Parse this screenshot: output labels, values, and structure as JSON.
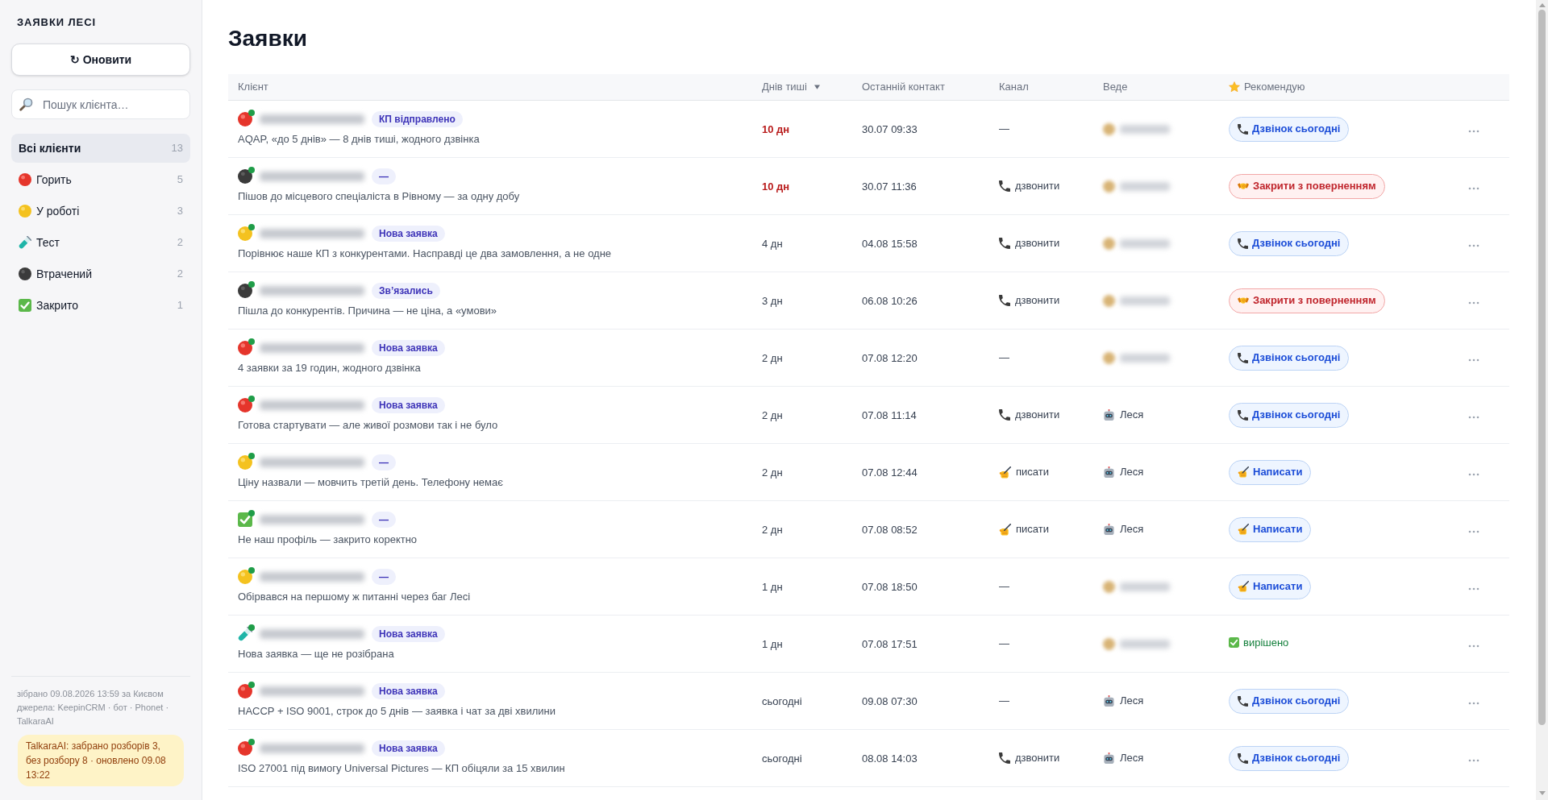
{
  "sidebar": {
    "title": "ЗАЯВКИ ЛЕСІ",
    "refresh_button": "↻ Оновити",
    "search": {
      "placeholder": "Пошук клієнта…"
    },
    "items": [
      {
        "kind": "all",
        "label": "Всі клієнти",
        "count": "13",
        "selected": true
      },
      {
        "kind": "hot",
        "label": "Горить",
        "count": "5",
        "selected": false
      },
      {
        "kind": "work",
        "label": "У роботі",
        "count": "3",
        "selected": false
      },
      {
        "kind": "test",
        "label": "Тест",
        "count": "2",
        "selected": false
      },
      {
        "kind": "lost",
        "label": "Втрачений",
        "count": "2",
        "selected": false
      },
      {
        "kind": "closed",
        "label": "Закрито",
        "count": "1",
        "selected": false
      }
    ],
    "footer": {
      "collected": "зібрано 09.08.2026 13:59 за Києвом",
      "sources": "джерела: KeepinCRM · бот · Phonet · TalkaraAI",
      "note": "TalkaraAI: забрано розборів 3, без розбору 8 · оновлено 09.08 13:22"
    }
  },
  "page_title": "Заявки",
  "table": {
    "columns": [
      {
        "label": "Клієнт",
        "sorted": false
      },
      {
        "label": "Днів тиші",
        "sorted": true
      },
      {
        "label": "Останній контакт",
        "sorted": false
      },
      {
        "label": "Канал",
        "sorted": false
      },
      {
        "label": "Веде",
        "sorted": false
      },
      {
        "label": "Рекомендую",
        "sorted": false
      }
    ],
    "rows": [
      {
        "kind": "hot",
        "badge": "КП відправлено",
        "note": "AQAP, «до 5 днів» — 8 днів тиші, жодного дзвінка",
        "days": "10 дн",
        "overdue": true,
        "last_contact": "30.07 09:33",
        "channel": {
          "kind": "none",
          "text": "—"
        },
        "owner": {
          "kind": "redacted"
        },
        "recommend": {
          "kind": "call",
          "text": "Дзвінок сьогодні"
        }
      },
      {
        "kind": "lost",
        "badge": "—",
        "note": "Пішов до місцевого спеціаліста в Рівному — за одну добу",
        "days": "10 дн",
        "overdue": true,
        "last_contact": "30.07 11:36",
        "channel": {
          "kind": "call",
          "text": "дзвонити"
        },
        "owner": {
          "kind": "redacted"
        },
        "recommend": {
          "kind": "return",
          "text": "Закрити з поверненням"
        }
      },
      {
        "kind": "work",
        "badge": "Нова заявка",
        "note": "Порівнює наше КП з конкурентами. Насправді це два замовлення, а не одне",
        "days": "4 дн",
        "overdue": false,
        "last_contact": "04.08 15:58",
        "channel": {
          "kind": "call",
          "text": "дзвонити"
        },
        "owner": {
          "kind": "redacted"
        },
        "recommend": {
          "kind": "call",
          "text": "Дзвінок сьогодні"
        }
      },
      {
        "kind": "lost",
        "badge": "Зв’язались",
        "note": "Пішла до конкурентів. Причина — не ціна, а «умови»",
        "days": "3 дн",
        "overdue": false,
        "last_contact": "06.08 10:26",
        "channel": {
          "kind": "call",
          "text": "дзвонити"
        },
        "owner": {
          "kind": "redacted"
        },
        "recommend": {
          "kind": "return",
          "text": "Закрити з поверненням"
        }
      },
      {
        "kind": "hot",
        "badge": "Нова заявка",
        "note": "4 заявки за 19 годин, жодного дзвінка",
        "days": "2 дн",
        "overdue": false,
        "last_contact": "07.08 12:20",
        "channel": {
          "kind": "none",
          "text": "—"
        },
        "owner": {
          "kind": "redacted"
        },
        "recommend": {
          "kind": "call",
          "text": "Дзвінок сьогодні"
        }
      },
      {
        "kind": "hot",
        "badge": "Нова заявка",
        "note": "Готова стартувати — але живої розмови так і не було",
        "days": "2 дн",
        "overdue": false,
        "last_contact": "07.08 11:14",
        "channel": {
          "kind": "call",
          "text": "дзвонити"
        },
        "owner": {
          "kind": "bot",
          "name": "Леся"
        },
        "recommend": {
          "kind": "call",
          "text": "Дзвінок сьогодні"
        }
      },
      {
        "kind": "work",
        "badge": "—",
        "note": "Ціну назвали — мовчить третій день. Телефону немає",
        "days": "2 дн",
        "overdue": false,
        "last_contact": "07.08 12:44",
        "channel": {
          "kind": "write",
          "text": "писати"
        },
        "owner": {
          "kind": "bot",
          "name": "Леся"
        },
        "recommend": {
          "kind": "write",
          "text": "Написати"
        }
      },
      {
        "kind": "closed",
        "badge": "—",
        "note": "Не наш профіль — закрито коректно",
        "days": "2 дн",
        "overdue": false,
        "last_contact": "07.08 08:52",
        "channel": {
          "kind": "write",
          "text": "писати"
        },
        "owner": {
          "kind": "bot",
          "name": "Леся"
        },
        "recommend": {
          "kind": "write",
          "text": "Написати"
        }
      },
      {
        "kind": "work",
        "badge": "—",
        "note": "Обірвався на першому ж питанні через баг Лесі",
        "days": "1 дн",
        "overdue": false,
        "last_contact": "07.08 18:50",
        "channel": {
          "kind": "none",
          "text": "—"
        },
        "owner": {
          "kind": "redacted"
        },
        "recommend": {
          "kind": "write",
          "text": "Написати"
        }
      },
      {
        "kind": "test",
        "badge": "Нова заявка",
        "note": "Нова заявка — ще не розібрана",
        "days": "1 дн",
        "overdue": false,
        "last_contact": "07.08 17:51",
        "channel": {
          "kind": "none",
          "text": "—"
        },
        "owner": {
          "kind": "redacted"
        },
        "recommend": {
          "kind": "done",
          "text": "вирішено"
        }
      },
      {
        "kind": "hot",
        "badge": "Нова заявка",
        "note": "HACCP + ISO 9001, строк до 5 днів — заявка і чат за дві хвилини",
        "days": "сьогодні",
        "overdue": false,
        "last_contact": "09.08 07:30",
        "channel": {
          "kind": "none",
          "text": "—"
        },
        "owner": {
          "kind": "bot",
          "name": "Леся"
        },
        "recommend": {
          "kind": "call",
          "text": "Дзвінок сьогодні"
        }
      },
      {
        "kind": "hot",
        "badge": "Нова заявка",
        "note": "ISO 27001 під вимогу Universal Pictures — КП обіцяли за 15 хвилин",
        "days": "сьогодні",
        "overdue": false,
        "last_contact": "08.08 14:03",
        "channel": {
          "kind": "call",
          "text": "дзвонити"
        },
        "owner": {
          "kind": "bot",
          "name": "Леся"
        },
        "recommend": {
          "kind": "call",
          "text": "Дзвінок сьогодні"
        }
      }
    ]
  }
}
